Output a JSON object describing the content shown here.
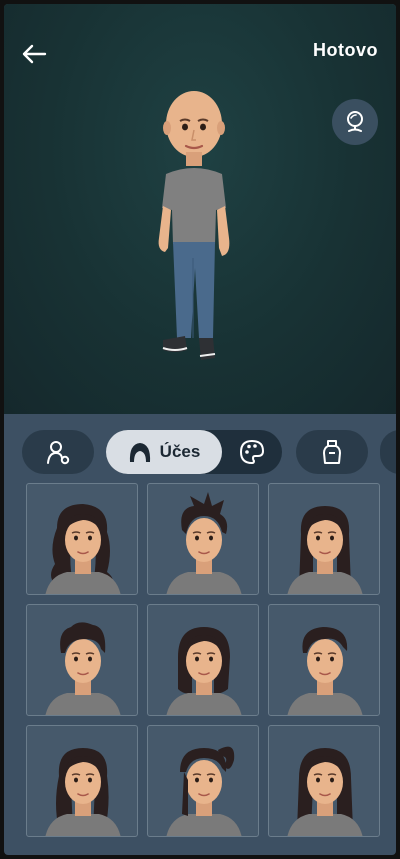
{
  "header": {
    "back_icon": "arrow-left-icon",
    "done_label": "Hotovo",
    "mirror_icon": "mirror-icon"
  },
  "categories": [
    {
      "name": "body",
      "icon": "body-shape-icon"
    },
    {
      "name": "hair",
      "label": "Účes",
      "icon": "hair-icon",
      "selected": true
    },
    {
      "name": "hair-color",
      "icon": "palette-icon"
    },
    {
      "name": "outfit",
      "icon": "clothing-icon"
    }
  ],
  "hairstyles": [
    {
      "style": "long-wavy"
    },
    {
      "style": "spiky-short"
    },
    {
      "style": "long-straight"
    },
    {
      "style": "short-quiff"
    },
    {
      "style": "bob"
    },
    {
      "style": "short-textured"
    },
    {
      "style": "long-layered"
    },
    {
      "style": "ponytail"
    },
    {
      "style": "long-parted"
    }
  ],
  "colors": {
    "accent_selected": "#d9dee4",
    "background": "#3d5063",
    "hair": "#2a1f1f",
    "skin": "#e8b48c"
  }
}
